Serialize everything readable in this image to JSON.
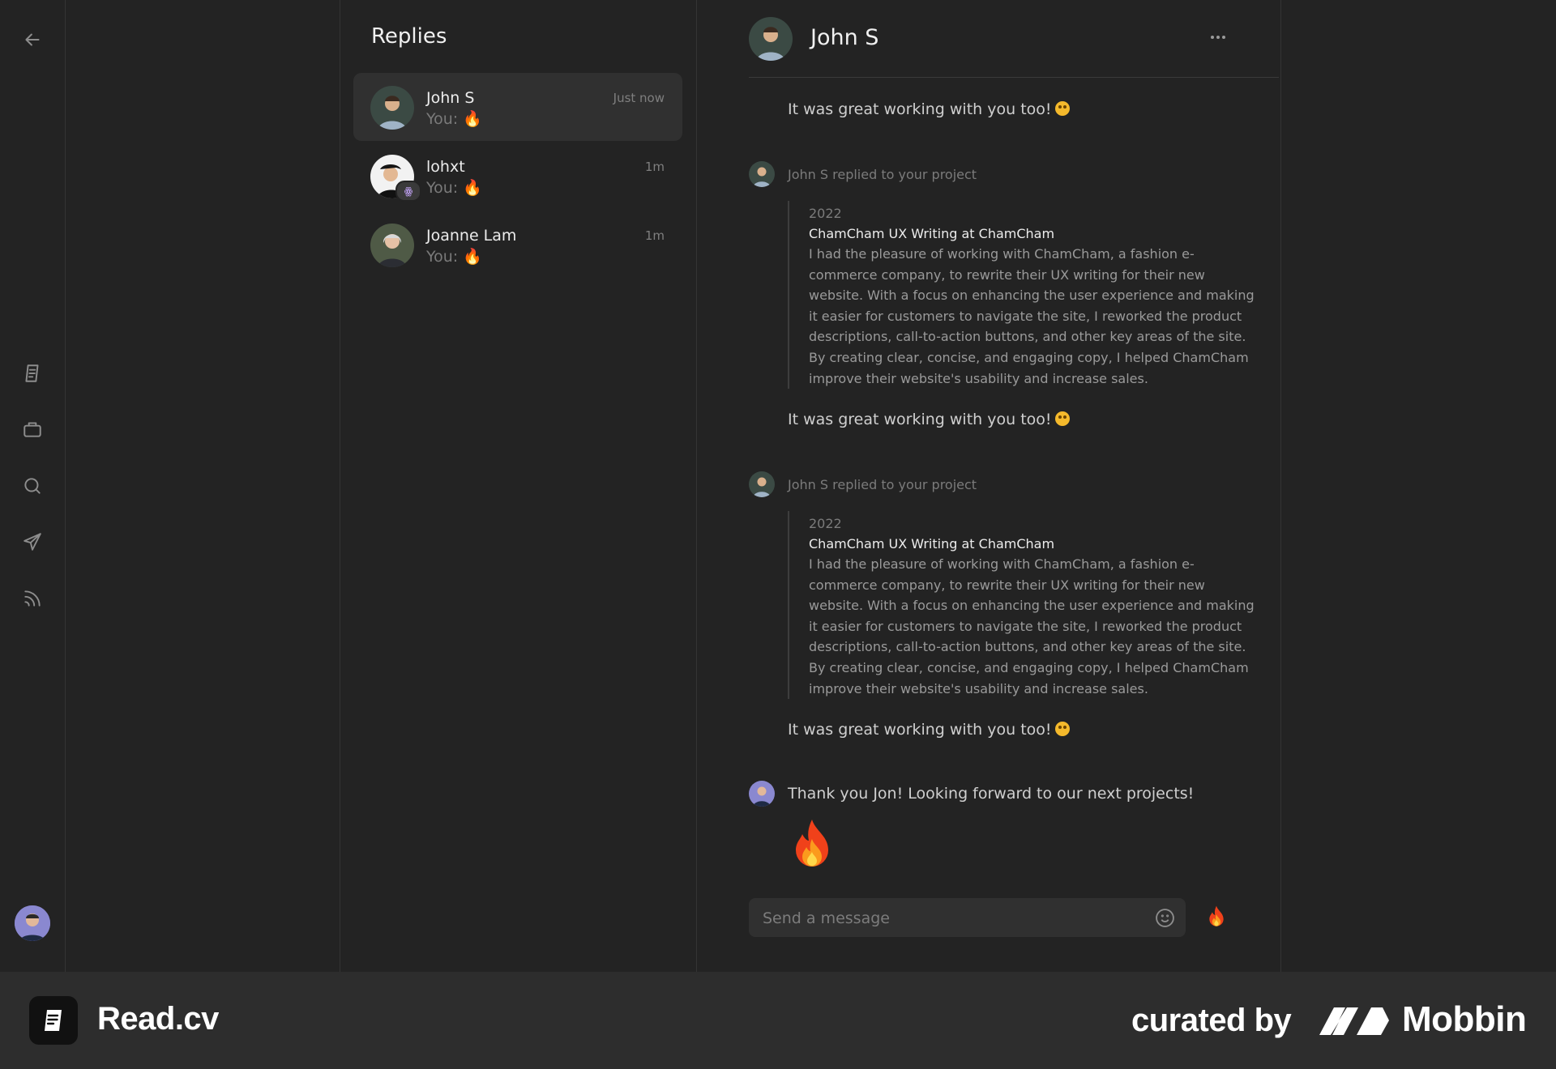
{
  "replies": {
    "title": "Replies",
    "conversations": [
      {
        "name": "John S",
        "preview": "You: 🔥",
        "time": "Just now"
      },
      {
        "name": "lohxt",
        "preview": "You: 🔥",
        "time": "1m"
      },
      {
        "name": "Joanne Lam",
        "preview": "You: 🔥",
        "time": "1m"
      }
    ]
  },
  "chat": {
    "contact_name": "John S",
    "messages": [
      {
        "text": "It was great working with you too!"
      },
      {
        "meta": "John S replied to your project",
        "year": "2022",
        "title": "ChamCham UX Writing at ChamCham",
        "body": "I had the pleasure of working with ChamCham, a fashion e-commerce company, to rewrite their UX writing for their new website. With a focus on enhancing the user experience and making it easier for customers to navigate the site, I reworked the product descriptions, call-to-action buttons, and other key areas of the site. By creating clear, concise, and engaging copy, I helped ChamCham improve their website's usability and increase sales.",
        "reply": "It was great working with you too!"
      },
      {
        "meta": "John S replied to your project",
        "year": "2022",
        "title": "ChamCham UX Writing at ChamCham",
        "body": "I had the pleasure of working with ChamCham, a fashion e-commerce company, to rewrite their UX writing for their new website. With a focus on enhancing the user experience and making it easier for customers to navigate the site, I reworked the product descriptions, call-to-action buttons, and other key areas of the site. By creating clear, concise, and engaging copy, I helped ChamCham improve their website's usability and increase sales.",
        "reply": "It was great working with you too!"
      },
      {
        "text": "Thank you Jon! Looking forward to our next projects!"
      }
    ],
    "input_placeholder": "Send a message"
  },
  "footer": {
    "app_name": "Read.cv",
    "curated_by": "curated by",
    "curator": "Mobbin"
  },
  "icons": [
    "back-arrow-icon",
    "document-icon",
    "briefcase-icon",
    "search-icon",
    "send-icon",
    "feed-icon",
    "more-icon",
    "smile-icon",
    "fire-icon"
  ],
  "colors": {
    "background": "#232323",
    "panel_active": "#303030",
    "text_primary": "#ececec",
    "text_muted": "#7b7b7b",
    "footer": "#2d2d2d"
  }
}
